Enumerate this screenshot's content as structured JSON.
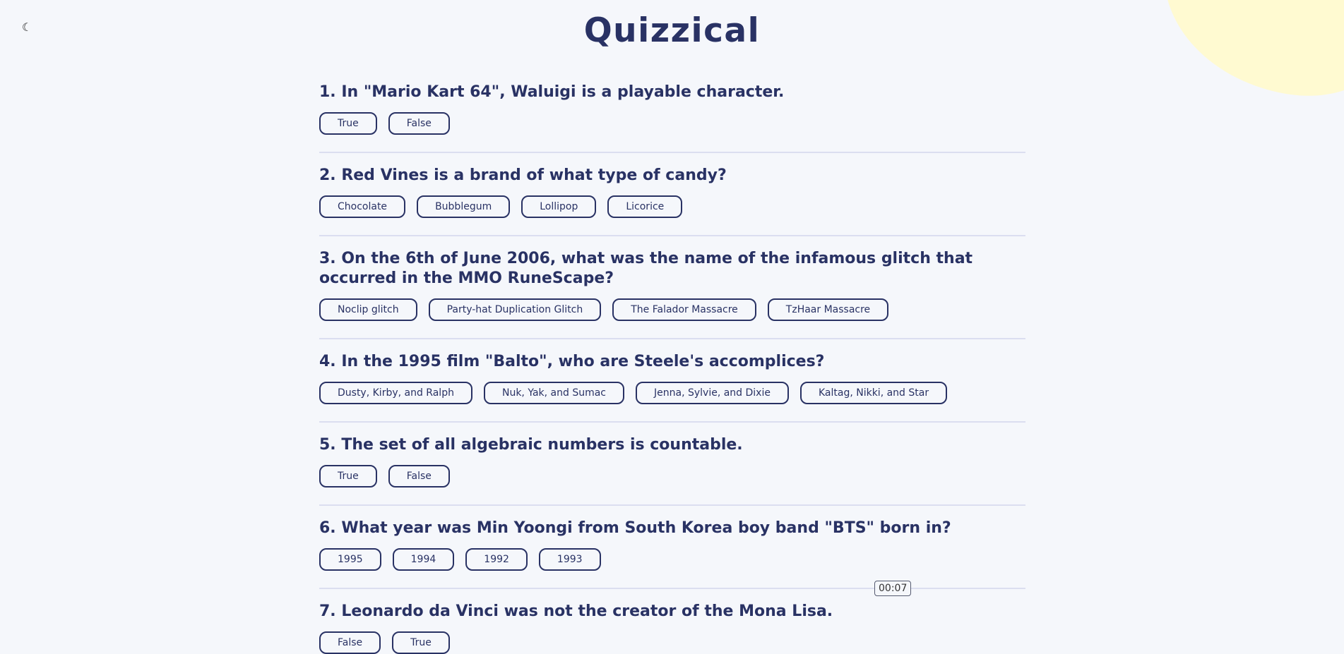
{
  "app": {
    "title": "Quizzical",
    "theme_toggle_icon": "moon-icon",
    "timer": "00:07"
  },
  "questions": [
    {
      "text": "1. In \"Mario Kart 64\", Waluigi is a playable character.",
      "answers": [
        "True",
        "False"
      ]
    },
    {
      "text": "2. Red Vines is a brand of what type of candy?",
      "answers": [
        "Chocolate",
        "Bubblegum",
        "Lollipop",
        "Licorice"
      ]
    },
    {
      "text": "3. On the 6th of June 2006, what was the name of the infamous glitch that occurred in the MMO RuneScape?",
      "answers": [
        "Noclip glitch",
        "Party-hat Duplication Glitch",
        "The Falador Massacre",
        "TzHaar Massacre"
      ]
    },
    {
      "text": "4. In the 1995 film \"Balto\", who are Steele's accomplices?",
      "answers": [
        "Dusty, Kirby, and Ralph",
        "Nuk, Yak, and Sumac",
        "Jenna, Sylvie, and Dixie",
        "Kaltag, Nikki, and Star"
      ]
    },
    {
      "text": "5. The set of all algebraic numbers is countable.",
      "answers": [
        "True",
        "False"
      ]
    },
    {
      "text": "6. What year was Min Yoongi from South Korea boy band \"BTS\" born in?",
      "answers": [
        "1995",
        "1994",
        "1992",
        "1993"
      ]
    },
    {
      "text": "7. Leonardo da Vinci was not the creator of the Mona Lisa.",
      "answers": [
        "False",
        "True"
      ]
    }
  ],
  "colors": {
    "background": "#f5f7fb",
    "primary": "#293264",
    "blob": "#fffad1",
    "divider": "#dbdef0"
  }
}
